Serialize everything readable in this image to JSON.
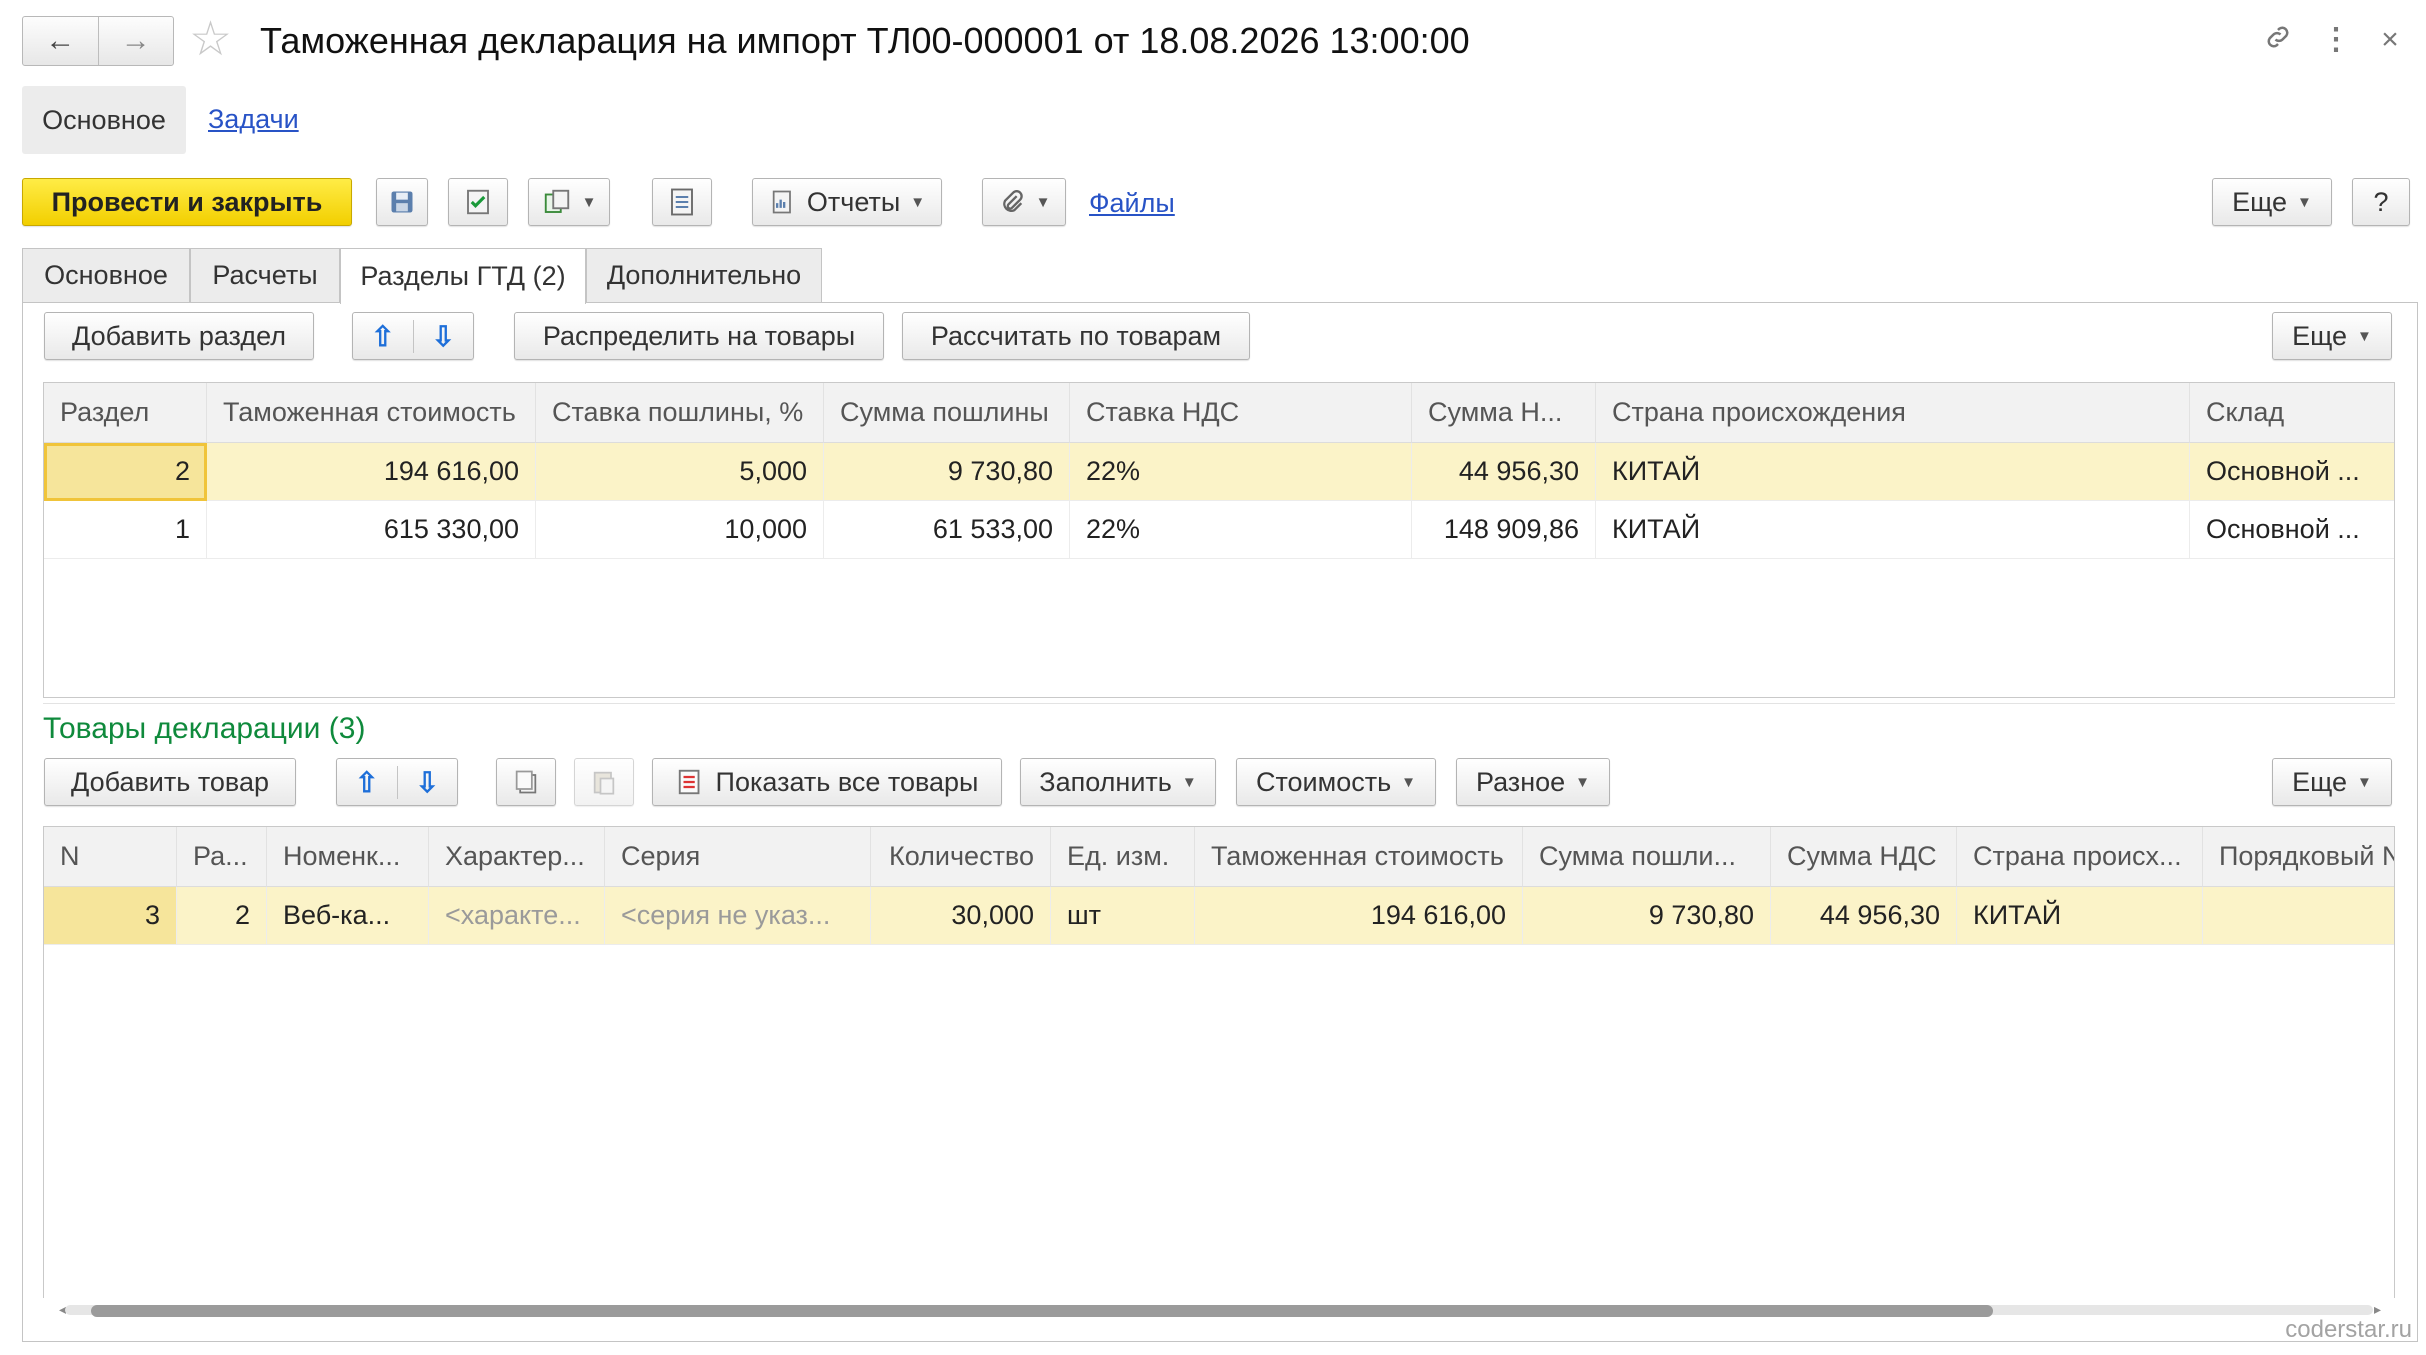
{
  "header": {
    "back_icon": "←",
    "forward_icon": "→",
    "favorite_icon": "☆",
    "title": "Таможенная декларация на импорт ТЛ00-000001 от 18.08.2026 13:00:00",
    "link_icon": "🔗",
    "more_icon": "⋮",
    "close_icon": "×"
  },
  "sections": {
    "main": "Основное",
    "tasks": "Задачи"
  },
  "toolbar": {
    "post_close": "Провести и закрыть",
    "reports": "Отчеты",
    "files": "Файлы",
    "more": "Еще",
    "help": "?"
  },
  "tabs": [
    "Основное",
    "Расчеты",
    "Разделы ГТД (2)",
    "Дополнительно"
  ],
  "sections_panel": {
    "add_section": "Добавить раздел",
    "distribute": "Распределить на товары",
    "calculate": "Рассчитать по товарам",
    "more": "Еще",
    "columns": [
      "Раздел",
      "Таможенная стоимость",
      "Ставка пошлины, %",
      "Сумма пошлины",
      "Ставка НДС",
      "Сумма Н...",
      "Страна происхождения",
      "Склад"
    ],
    "rows": [
      [
        "2",
        "194 616,00",
        "5,000",
        "9 730,80",
        "22%",
        "44 956,30",
        "КИТАЙ",
        "Основной ..."
      ],
      [
        "1",
        "615 330,00",
        "10,000",
        "61 533,00",
        "22%",
        "148 909,86",
        "КИТАЙ",
        "Основной ..."
      ]
    ]
  },
  "goods": {
    "title": "Товары декларации (3)",
    "add_item": "Добавить товар",
    "show_all": "Показать все товары",
    "fill": "Заполнить",
    "cost": "Стоимость",
    "misc": "Разное",
    "more": "Еще",
    "columns": [
      "N",
      "Ра...",
      "Номенк...",
      "Характер...",
      "Серия",
      "Количество",
      "Ед. изм.",
      "Таможенная стоимость",
      "Сумма пошли...",
      "Сумма НДС",
      "Страна происх...",
      "Порядковый N"
    ],
    "rows": [
      [
        "3",
        "2",
        "Веб-ка...",
        "<характе...",
        "<серия не указ...",
        "30,000",
        "шт",
        "194 616,00",
        "9 730,80",
        "44 956,30",
        "КИТАЙ",
        ""
      ]
    ],
    "scroll_position": 0.02
  },
  "watermark": "coderstar.ru",
  "colors": {
    "primary_button": "#f5d800",
    "link": "#2853c6",
    "group_title": "#0f8a3c",
    "row_selected": "#fbf3c8"
  }
}
